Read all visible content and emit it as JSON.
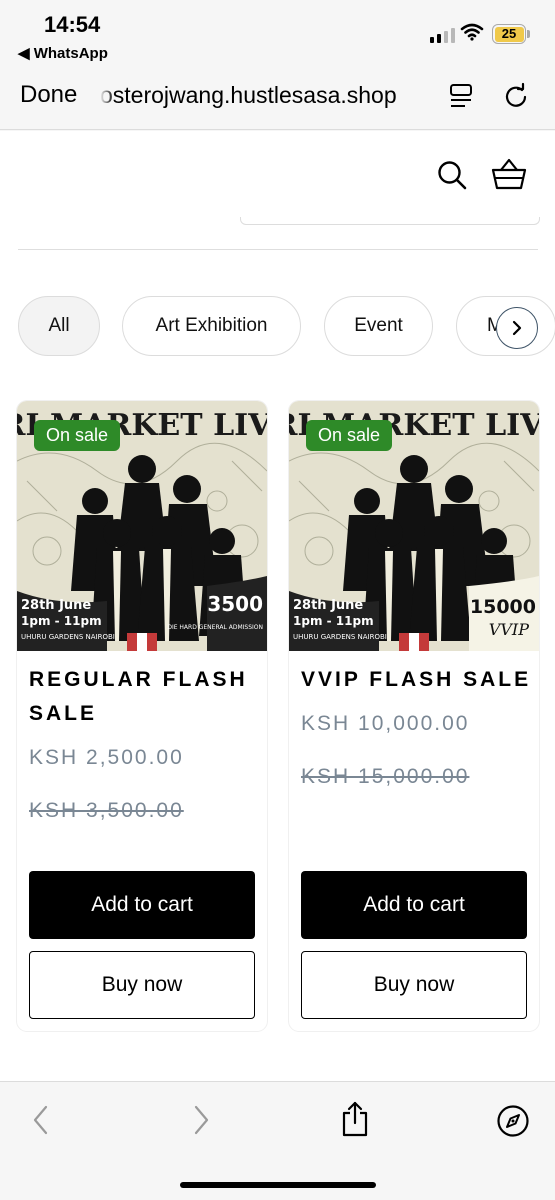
{
  "status_bar": {
    "time": "14:54",
    "back_app": "◀ WhatsApp",
    "battery": "25"
  },
  "browser": {
    "done_label": "Done",
    "url": "osterojwang.hustlesasa.shop"
  },
  "categories": [
    {
      "label": "All",
      "active": true
    },
    {
      "label": "Art Exhibition",
      "active": false
    },
    {
      "label": "Event",
      "active": false
    },
    {
      "label": "M",
      "active": false
    }
  ],
  "products": [
    {
      "badge": "On sale",
      "title": "REGULAR FLASH SALE",
      "price": "KSH 2,500.00",
      "compare_price": "KSH 3,500.00",
      "poster": {
        "heading": "FRI MARKET LIVE.",
        "date": "28th June",
        "hours": "1pm - 11pm",
        "venue": "UHURU GARDENS NAIROBI",
        "amount": "3500",
        "tier": "DIE HARD GENERAL ADMISSION"
      },
      "add_to_cart": "Add to cart",
      "buy_now": "Buy now"
    },
    {
      "badge": "On sale",
      "title": "VVIP FLASH SALE",
      "price": "KSH 10,000.00",
      "compare_price": "KSH 15,000.00",
      "poster": {
        "heading": "FRI MARKET LIVE.",
        "date": "28th June",
        "hours": "1pm - 11pm",
        "venue": "UHURU GARDENS NAIROBI",
        "amount": "15000",
        "tier": "VVIP"
      },
      "add_to_cart": "Add to cart",
      "buy_now": "Buy now"
    }
  ],
  "icons": {
    "search": "search-icon",
    "cart": "basket-icon",
    "reader": "reader-icon",
    "reload": "reload-icon",
    "back": "chevron-left-icon",
    "forward": "chevron-right-icon",
    "share": "share-icon",
    "compass": "compass-icon"
  },
  "colors": {
    "badge": "#2e8a28",
    "price": "#7a8794",
    "primary_button": "#000000"
  }
}
